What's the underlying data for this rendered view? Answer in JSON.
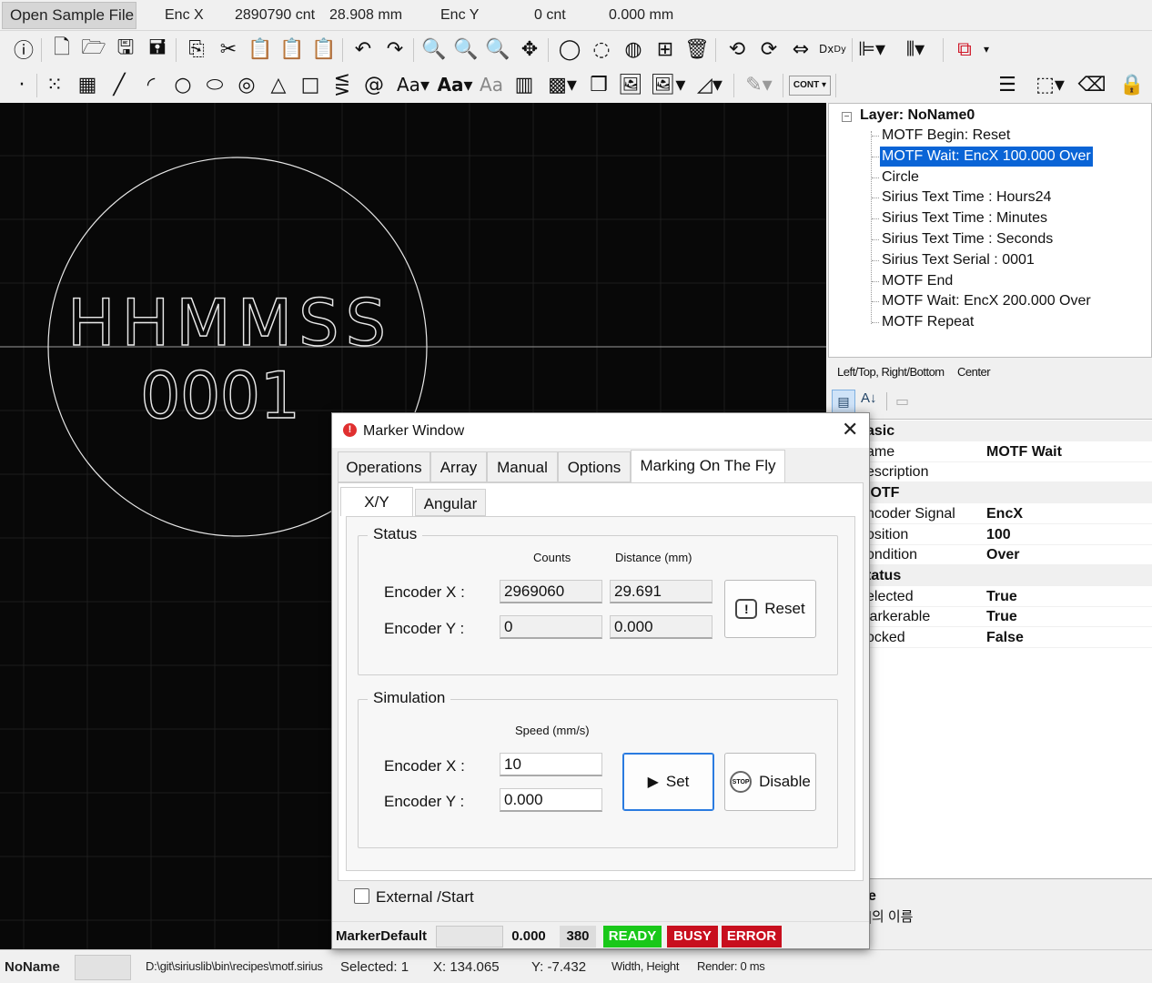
{
  "top": {
    "open_button": "Open Sample File",
    "encx_label": "Enc X",
    "encx_cnt": "2890790 cnt",
    "encx_mm": "28.908 mm",
    "ency_label": "Enc Y",
    "ency_cnt": "0 cnt",
    "ency_mm": "0.000 mm"
  },
  "toolbar2": {
    "cont_label": "CONT",
    "text_aa": "Aa",
    "text_aa_bold": "Aa",
    "text_aa_outline": "Aa"
  },
  "canvas": {
    "line1": "HHMMSS",
    "line2": "0001"
  },
  "tree": {
    "root": "Layer: NoName0",
    "items": [
      "MOTF Begin: Reset",
      "MOTF Wait: EncX 100.000 Over",
      "Circle",
      "Sirius Text Time : Hours24",
      "Sirius Text Time : Minutes",
      "Sirius Text Time : Seconds",
      "Sirius Text Serial : 0001",
      "MOTF End",
      "MOTF Wait: EncX 200.000 Over",
      "MOTF Repeat"
    ]
  },
  "align": {
    "left_top": "Left/Top, Right/Bottom",
    "center": "Center"
  },
  "props": {
    "rows": [
      {
        "name": "asic",
        "value": "",
        "cat": true
      },
      {
        "name": "ame",
        "value": "MOTF Wait",
        "cat": false
      },
      {
        "name": "escription",
        "value": "",
        "cat": false
      },
      {
        "name": "IOTF",
        "value": "",
        "cat": true
      },
      {
        "name": "ncoder Signal",
        "value": "EncX",
        "cat": false
      },
      {
        "name": "osition",
        "value": "100",
        "cat": false
      },
      {
        "name": "ondition",
        "value": "Over",
        "cat": false
      },
      {
        "name": "tatus",
        "value": "",
        "cat": true
      },
      {
        "name": "elected",
        "value": "True",
        "cat": false
      },
      {
        "name": "larkerable",
        "value": "True",
        "cat": false
      },
      {
        "name": "ocked",
        "value": "False",
        "cat": false
      }
    ],
    "desc_title": "e",
    "desc_text": "|의 이름"
  },
  "modal": {
    "title": "Marker Window",
    "tabs": [
      "Operations",
      "Array",
      "Manual",
      "Options",
      "Marking On The Fly"
    ],
    "subtabs": [
      "X/Y",
      "Angular"
    ],
    "status": {
      "title": "Status",
      "col_counts": "Counts",
      "col_distance": "Distance (mm)",
      "encx_label": "Encoder X :",
      "ency_label": "Encoder Y :",
      "encx_counts": "2969060",
      "encx_dist": "29.691",
      "ency_counts": "0",
      "ency_dist": "0.000",
      "reset_label": "Reset"
    },
    "simulation": {
      "title": "Simulation",
      "col_speed": "Speed (mm/s)",
      "encx_label": "Encoder X :",
      "ency_label": "Encoder Y :",
      "encx_speed": "10",
      "ency_speed": "0.000",
      "set_label": "Set",
      "disable_label": "Disable"
    },
    "external_start": "External /Start",
    "bottom": {
      "marker": "MarkerDefault",
      "value": "0.000",
      "count": "380",
      "ready": "READY",
      "busy": "BUSY",
      "error": "ERROR"
    }
  },
  "statusbar": {
    "name": "NoName",
    "path": "D:\\git\\siriuslib\\bin\\recipes\\motf.sirius",
    "selected": "Selected: 1",
    "x": "X: 134.065",
    "y": "Y: -7.432",
    "wh": "Width, Height",
    "render": "Render: 0 ms"
  },
  "colors": {
    "selection": "#0a64d6",
    "ready": "#19c819",
    "busy": "#c80f1e",
    "error": "#c80f1e"
  }
}
